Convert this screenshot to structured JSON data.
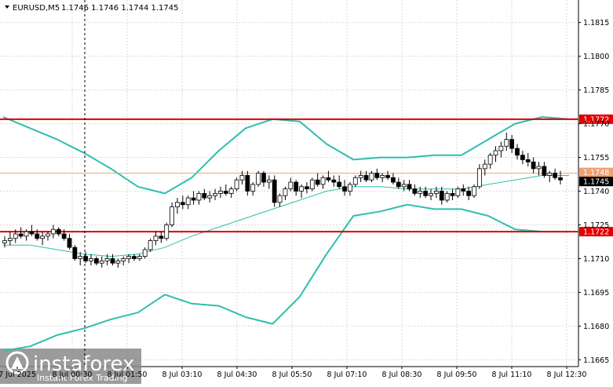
{
  "header": {
    "symbol": "EURUSD,M5",
    "ohlc": "1.1746 1.1746 1.1744 1.1745"
  },
  "colors": {
    "background": "#ffffff",
    "grid": "#d9d9d9",
    "bull_body": "#ffffff",
    "bear_body": "#000000",
    "candle_line": "#000000",
    "bollinger": "#2ebfae",
    "ma": "#2ebfae",
    "resistance": "#e00000",
    "current_price_line": "#f0a070",
    "current_price_box": "#000000",
    "watermark": "#ffffff"
  },
  "watermark": {
    "brand": "instaforex",
    "tagline": "Instant Forex Trading"
  },
  "chart_data": {
    "type": "candlestick",
    "symbol": "EURUSD",
    "timeframe": "M5",
    "ylim": [
      1.1662,
      1.1825
    ],
    "y_ticks": [
      "1.1815",
      "1.1800",
      "1.1785",
      "1.1770",
      "1.1755",
      "1.1740",
      "1.1725",
      "1.1710",
      "1.1695",
      "1.1680",
      "1.1665"
    ],
    "x_ticks": [
      "7 Jul 2025",
      "8 Jul 00:30",
      "8 Jul 01:50",
      "8 Jul 03:10",
      "8 Jul 04:30",
      "8 Jul 05:50",
      "8 Jul 07:10",
      "8 Jul 08:30",
      "8 Jul 09:50",
      "8 Jul 11:10",
      "8 Jul 12:30"
    ],
    "levels": [
      {
        "label": "1.1772",
        "value": 1.1772,
        "color": "#e00000"
      },
      {
        "label": "1.1722",
        "value": 1.1722,
        "color": "#e00000"
      }
    ],
    "price_labels": [
      {
        "label": "1.1748",
        "value": 1.1748
      },
      {
        "label": "1.1745",
        "value": 1.1745
      }
    ],
    "current_price": 1.1745,
    "candles": [
      [
        1.1717,
        1.172,
        1.1715,
        1.1718
      ],
      [
        1.1718,
        1.1722,
        1.1716,
        1.1719
      ],
      [
        1.1719,
        1.1723,
        1.1717,
        1.1721
      ],
      [
        1.1721,
        1.1724,
        1.1719,
        1.172
      ],
      [
        1.172,
        1.1723,
        1.1718,
        1.1722
      ],
      [
        1.1722,
        1.1725,
        1.172,
        1.1721
      ],
      [
        1.1721,
        1.1723,
        1.1718,
        1.1719
      ],
      [
        1.1719,
        1.1722,
        1.1716,
        1.172
      ],
      [
        1.172,
        1.1722,
        1.1718,
        1.1721
      ],
      [
        1.1721,
        1.1725,
        1.1719,
        1.1723
      ],
      [
        1.1723,
        1.1724,
        1.172,
        1.1721
      ],
      [
        1.1721,
        1.1723,
        1.1718,
        1.1719
      ],
      [
        1.1719,
        1.1721,
        1.1714,
        1.1715
      ],
      [
        1.1715,
        1.1716,
        1.1709,
        1.171
      ],
      [
        1.171,
        1.1713,
        1.1707,
        1.1711
      ],
      [
        1.1711,
        1.1713,
        1.1708,
        1.1709
      ],
      [
        1.1709,
        1.1712,
        1.1707,
        1.171
      ],
      [
        1.171,
        1.1711,
        1.1707,
        1.1708
      ],
      [
        1.1708,
        1.1711,
        1.1706,
        1.1709
      ],
      [
        1.1709,
        1.1712,
        1.1707,
        1.171
      ],
      [
        1.171,
        1.1712,
        1.1707,
        1.1708
      ],
      [
        1.1708,
        1.171,
        1.1706,
        1.1709
      ],
      [
        1.1709,
        1.1711,
        1.1707,
        1.171
      ],
      [
        1.171,
        1.1712,
        1.1708,
        1.1711
      ],
      [
        1.1711,
        1.1712,
        1.1709,
        1.171
      ],
      [
        1.171,
        1.1712,
        1.1709,
        1.1711
      ],
      [
        1.1711,
        1.1715,
        1.171,
        1.1714
      ],
      [
        1.1714,
        1.1719,
        1.1713,
        1.1718
      ],
      [
        1.1718,
        1.1722,
        1.1716,
        1.172
      ],
      [
        1.172,
        1.1722,
        1.1717,
        1.1719
      ],
      [
        1.1719,
        1.1726,
        1.1718,
        1.1725
      ],
      [
        1.1725,
        1.1735,
        1.1724,
        1.1733
      ],
      [
        1.1733,
        1.1737,
        1.173,
        1.1735
      ],
      [
        1.1735,
        1.1738,
        1.1732,
        1.1734
      ],
      [
        1.1734,
        1.1738,
        1.1732,
        1.1737
      ],
      [
        1.1737,
        1.174,
        1.1734,
        1.1736
      ],
      [
        1.1736,
        1.174,
        1.1734,
        1.1739
      ],
      [
        1.1739,
        1.1741,
        1.1736,
        1.1737
      ],
      [
        1.1737,
        1.174,
        1.1735,
        1.1738
      ],
      [
        1.1738,
        1.1741,
        1.1736,
        1.1739
      ],
      [
        1.1739,
        1.1742,
        1.1737,
        1.174
      ],
      [
        1.174,
        1.1743,
        1.1738,
        1.1739
      ],
      [
        1.1739,
        1.1742,
        1.1737,
        1.1741
      ],
      [
        1.1741,
        1.1746,
        1.174,
        1.1745
      ],
      [
        1.1745,
        1.1749,
        1.1743,
        1.1747
      ],
      [
        1.1747,
        1.1749,
        1.1738,
        1.174
      ],
      [
        1.174,
        1.1744,
        1.1738,
        1.1743
      ],
      [
        1.1743,
        1.1749,
        1.1742,
        1.1748
      ],
      [
        1.1748,
        1.1749,
        1.1742,
        1.1744
      ],
      [
        1.1744,
        1.1747,
        1.1741,
        1.1745
      ],
      [
        1.1745,
        1.1747,
        1.1733,
        1.1735
      ],
      [
        1.1735,
        1.1739,
        1.1733,
        1.1738
      ],
      [
        1.1738,
        1.1742,
        1.1736,
        1.1741
      ],
      [
        1.1741,
        1.1746,
        1.174,
        1.1744
      ],
      [
        1.1744,
        1.1745,
        1.1738,
        1.174
      ],
      [
        1.174,
        1.1743,
        1.1737,
        1.1742
      ],
      [
        1.1742,
        1.1744,
        1.1739,
        1.1741
      ],
      [
        1.1741,
        1.1746,
        1.174,
        1.1745
      ],
      [
        1.1745,
        1.1748,
        1.1742,
        1.1743
      ],
      [
        1.1743,
        1.1747,
        1.1741,
        1.1746
      ],
      [
        1.1746,
        1.1749,
        1.1744,
        1.1745
      ],
      [
        1.1745,
        1.1747,
        1.1742,
        1.1744
      ],
      [
        1.1744,
        1.1747,
        1.1741,
        1.1742
      ],
      [
        1.1742,
        1.1745,
        1.1738,
        1.174
      ],
      [
        1.174,
        1.1744,
        1.1738,
        1.1743
      ],
      [
        1.1743,
        1.1747,
        1.1742,
        1.1746
      ],
      [
        1.1746,
        1.1749,
        1.1744,
        1.1747
      ],
      [
        1.1747,
        1.1749,
        1.1744,
        1.1745
      ],
      [
        1.1745,
        1.1749,
        1.1744,
        1.1748
      ],
      [
        1.1748,
        1.175,
        1.1745,
        1.1746
      ],
      [
        1.1746,
        1.1748,
        1.1744,
        1.1747
      ],
      [
        1.1747,
        1.1749,
        1.1745,
        1.1746
      ],
      [
        1.1746,
        1.1748,
        1.1743,
        1.1744
      ],
      [
        1.1744,
        1.1746,
        1.1741,
        1.1742
      ],
      [
        1.1742,
        1.1745,
        1.174,
        1.1743
      ],
      [
        1.1743,
        1.1745,
        1.174,
        1.1741
      ],
      [
        1.1741,
        1.1743,
        1.1738,
        1.1739
      ],
      [
        1.1739,
        1.1742,
        1.1737,
        1.174
      ],
      [
        1.174,
        1.1742,
        1.1737,
        1.1738
      ],
      [
        1.1738,
        1.1741,
        1.1736,
        1.1739
      ],
      [
        1.1739,
        1.1742,
        1.1737,
        1.174
      ],
      [
        1.174,
        1.1742,
        1.1734,
        1.1736
      ],
      [
        1.1736,
        1.174,
        1.1735,
        1.1739
      ],
      [
        1.1739,
        1.1741,
        1.1736,
        1.1738
      ],
      [
        1.1738,
        1.1742,
        1.1737,
        1.1741
      ],
      [
        1.1741,
        1.1743,
        1.1738,
        1.174
      ],
      [
        1.174,
        1.1742,
        1.1736,
        1.1738
      ],
      [
        1.1738,
        1.1743,
        1.1737,
        1.1742
      ],
      [
        1.1742,
        1.1752,
        1.1741,
        1.175
      ],
      [
        1.175,
        1.1754,
        1.1747,
        1.1752
      ],
      [
        1.1752,
        1.1757,
        1.175,
        1.1756
      ],
      [
        1.1756,
        1.176,
        1.1753,
        1.1758
      ],
      [
        1.1758,
        1.1762,
        1.1755,
        1.176
      ],
      [
        1.176,
        1.1766,
        1.1758,
        1.1763
      ],
      [
        1.1763,
        1.1765,
        1.1757,
        1.1759
      ],
      [
        1.1759,
        1.1761,
        1.1754,
        1.1756
      ],
      [
        1.1756,
        1.1758,
        1.1752,
        1.1754
      ],
      [
        1.1754,
        1.1757,
        1.1751,
        1.1753
      ],
      [
        1.1753,
        1.1755,
        1.1748,
        1.175
      ],
      [
        1.175,
        1.1753,
        1.1747,
        1.1751
      ],
      [
        1.1751,
        1.1753,
        1.1746,
        1.1747
      ],
      [
        1.1747,
        1.1749,
        1.1744,
        1.1748
      ],
      [
        1.1748,
        1.175,
        1.1745,
        1.1746
      ],
      [
        1.1746,
        1.1749,
        1.1743,
        1.1745
      ]
    ],
    "bb_upper": [
      1.1773,
      1.1768,
      1.1763,
      1.1757,
      1.175,
      1.1742,
      1.1739,
      1.1746,
      1.1758,
      1.1768,
      1.1772,
      1.1771,
      1.1761,
      1.1754,
      1.1755,
      1.1755,
      1.1756,
      1.1756,
      1.1763,
      1.177,
      1.1773,
      1.1772
    ],
    "bb_middle": [
      1.1716,
      1.1716,
      1.1714,
      1.1712,
      1.1711,
      1.1712,
      1.1715,
      1.172,
      1.1724,
      1.1728,
      1.1732,
      1.1736,
      1.174,
      1.1742,
      1.1742,
      1.1741,
      1.1741,
      1.1741,
      1.1743,
      1.1745,
      1.1747,
      1.1747
    ],
    "bb_lower": [
      1.1669,
      1.1671,
      1.1676,
      1.1679,
      1.1683,
      1.1686,
      1.1694,
      1.169,
      1.1689,
      1.1684,
      1.1681,
      1.1693,
      1.1712,
      1.1729,
      1.1731,
      1.1734,
      1.1732,
      1.1732,
      1.1729,
      1.1723,
      1.1722,
      1.1722
    ]
  }
}
